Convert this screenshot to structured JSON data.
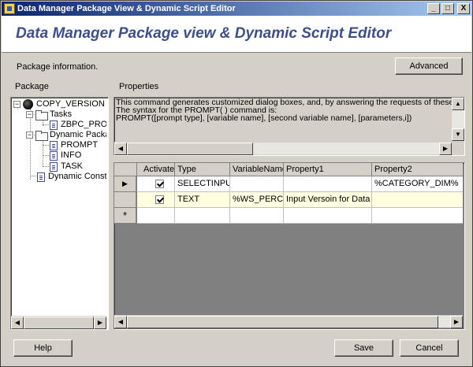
{
  "window": {
    "title": "Data Manager Package View & Dynamic Script Editor",
    "controls": {
      "minimize": "_",
      "maximize": "□",
      "close": "X"
    }
  },
  "header": {
    "title": "Data Manager Package view & Dynamic Script Editor"
  },
  "package_info_label": "Package information.",
  "advanced_button": "Advanced",
  "package_label": "Package",
  "properties_label": "Properties",
  "tree": {
    "root": "COPY_VERSION",
    "tasks": "Tasks",
    "task_item": "ZBPC_PROMPT",
    "dynamic_package": "Dynamic Package",
    "dp_items": [
      "PROMPT",
      "INFO",
      "TASK"
    ],
    "dynamic_constants": "Dynamic Constants"
  },
  "properties_text": [
    "This command generates customized dialog boxes, and, by answering the requests of these dialogs, the user te",
    "The syntax for the PROMPT( ) command is:",
    "PROMPT([prompt type], [variable name], [second variable name], [parameters,i])"
  ],
  "grid": {
    "columns": [
      "Activate",
      "Type",
      "VariableName",
      "Property1",
      "Property2"
    ],
    "rows": [
      {
        "activate": true,
        "type": "SELECTINPUT",
        "variable": "",
        "property1": "",
        "property2": "%CATEGORY_DIM%"
      },
      {
        "activate": true,
        "type": "TEXT",
        "variable": "%WS_PERCT",
        "property1": "Input Versoin for Data loa",
        "property2": ""
      }
    ],
    "new_row_marker": "*",
    "current_row_marker": "▶"
  },
  "buttons": {
    "help": "Help",
    "save": "Save",
    "cancel": "Cancel"
  },
  "icons": {
    "scroll_left": "◀",
    "scroll_right": "▶",
    "scroll_up": "▲",
    "scroll_down": "▼"
  }
}
